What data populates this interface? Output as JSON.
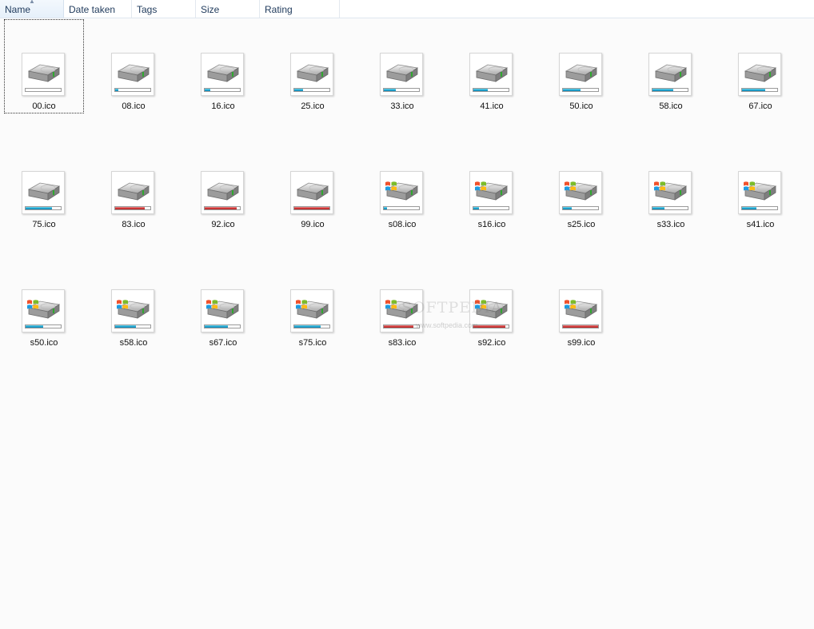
{
  "columns": [
    {
      "label": "Name",
      "sorted": true
    },
    {
      "label": "Date taken"
    },
    {
      "label": "Tags"
    },
    {
      "label": "Size"
    },
    {
      "label": "Rating"
    }
  ],
  "files": [
    {
      "name": "00.ico",
      "fill": 0,
      "color": "blue",
      "windows": false
    },
    {
      "name": "08.ico",
      "fill": 8,
      "color": "blue",
      "windows": false
    },
    {
      "name": "16.ico",
      "fill": 16,
      "color": "blue",
      "windows": false
    },
    {
      "name": "25.ico",
      "fill": 25,
      "color": "blue",
      "windows": false
    },
    {
      "name": "33.ico",
      "fill": 33,
      "color": "blue",
      "windows": false
    },
    {
      "name": "41.ico",
      "fill": 41,
      "color": "blue",
      "windows": false
    },
    {
      "name": "50.ico",
      "fill": 50,
      "color": "blue",
      "windows": false
    },
    {
      "name": "58.ico",
      "fill": 58,
      "color": "blue",
      "windows": false
    },
    {
      "name": "67.ico",
      "fill": 67,
      "color": "blue",
      "windows": false
    },
    {
      "name": "75.ico",
      "fill": 75,
      "color": "blue",
      "windows": false
    },
    {
      "name": "83.ico",
      "fill": 83,
      "color": "red",
      "windows": false
    },
    {
      "name": "92.ico",
      "fill": 92,
      "color": "red",
      "windows": false
    },
    {
      "name": "99.ico",
      "fill": 99,
      "color": "red",
      "windows": false
    },
    {
      "name": "s08.ico",
      "fill": 8,
      "color": "blue",
      "windows": true
    },
    {
      "name": "s16.ico",
      "fill": 16,
      "color": "blue",
      "windows": true
    },
    {
      "name": "s25.ico",
      "fill": 25,
      "color": "blue",
      "windows": true
    },
    {
      "name": "s33.ico",
      "fill": 33,
      "color": "blue",
      "windows": true
    },
    {
      "name": "s41.ico",
      "fill": 41,
      "color": "blue",
      "windows": true
    },
    {
      "name": "s50.ico",
      "fill": 50,
      "color": "blue",
      "windows": true
    },
    {
      "name": "s58.ico",
      "fill": 58,
      "color": "blue",
      "windows": true
    },
    {
      "name": "s67.ico",
      "fill": 67,
      "color": "blue",
      "windows": true
    },
    {
      "name": "s75.ico",
      "fill": 75,
      "color": "blue",
      "windows": true
    },
    {
      "name": "s83.ico",
      "fill": 83,
      "color": "red",
      "windows": true
    },
    {
      "name": "s92.ico",
      "fill": 92,
      "color": "red",
      "windows": true
    },
    {
      "name": "s99.ico",
      "fill": 99,
      "color": "red",
      "windows": true
    }
  ],
  "icons": {
    "drive": "hard-drive-icon",
    "windows_logo": "windows-logo-icon"
  },
  "colors": {
    "bar_blue": "#1ea5cf",
    "bar_red": "#d23a3a",
    "header_text": "#1e395b"
  },
  "watermark": {
    "text": "SOFTPEDIA",
    "url": "www.softpedia.com"
  }
}
